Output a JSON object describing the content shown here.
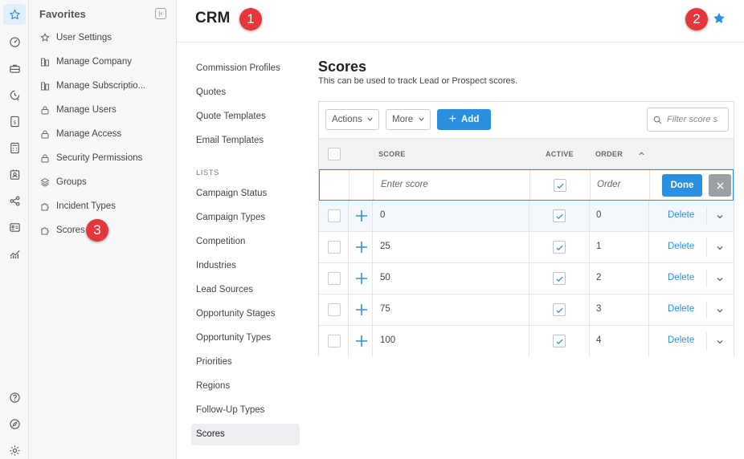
{
  "header": {
    "title": "CRM"
  },
  "favorites": {
    "title": "Favorites",
    "items": [
      {
        "label": "User Settings",
        "icon": "star-outline-icon"
      },
      {
        "label": "Manage Company",
        "icon": "building-icon"
      },
      {
        "label": "Manage Subscriptio...",
        "icon": "building-icon"
      },
      {
        "label": "Manage Users",
        "icon": "lock-icon"
      },
      {
        "label": "Manage Access",
        "icon": "lock-icon"
      },
      {
        "label": "Security Permissions",
        "icon": "lock-icon"
      },
      {
        "label": "Groups",
        "icon": "layers-icon"
      },
      {
        "label": "Incident Types",
        "icon": "puzzle-icon"
      },
      {
        "label": "Scores",
        "icon": "puzzle-icon"
      }
    ]
  },
  "settings_nav": {
    "items": [
      "Commission Profiles",
      "Quotes",
      "Quote Templates",
      "Email Templates"
    ],
    "lists_label": "LISTS",
    "list_items": [
      "Campaign Status",
      "Campaign Types",
      "Competition",
      "Industries",
      "Lead Sources",
      "Opportunity Stages",
      "Opportunity Types",
      "Priorities",
      "Regions",
      "Follow-Up Types",
      "Scores"
    ],
    "active": "Scores"
  },
  "content": {
    "title": "Scores",
    "subtitle": "This can be used to track Lead or Prospect scores."
  },
  "toolbar": {
    "actions_label": "Actions",
    "more_label": "More",
    "add_label": "Add",
    "filter_placeholder": "Filter score s"
  },
  "table": {
    "columns": {
      "score": "SCORE",
      "active": "ACTIVE",
      "order": "ORDER"
    },
    "edit_row": {
      "score_placeholder": "Enter score",
      "order_placeholder": "Order",
      "active": true,
      "done_label": "Done"
    },
    "delete_label": "Delete",
    "rows": [
      {
        "score": "0",
        "active": true,
        "order": "0"
      },
      {
        "score": "25",
        "active": true,
        "order": "1"
      },
      {
        "score": "50",
        "active": true,
        "order": "2"
      },
      {
        "score": "75",
        "active": true,
        "order": "3"
      },
      {
        "score": "100",
        "active": true,
        "order": "4"
      }
    ]
  },
  "callouts": [
    "1",
    "2",
    "3"
  ],
  "colors": {
    "accent": "#2b8fe0",
    "callout": "#e5373b",
    "rail_active": "#e3eefb"
  }
}
